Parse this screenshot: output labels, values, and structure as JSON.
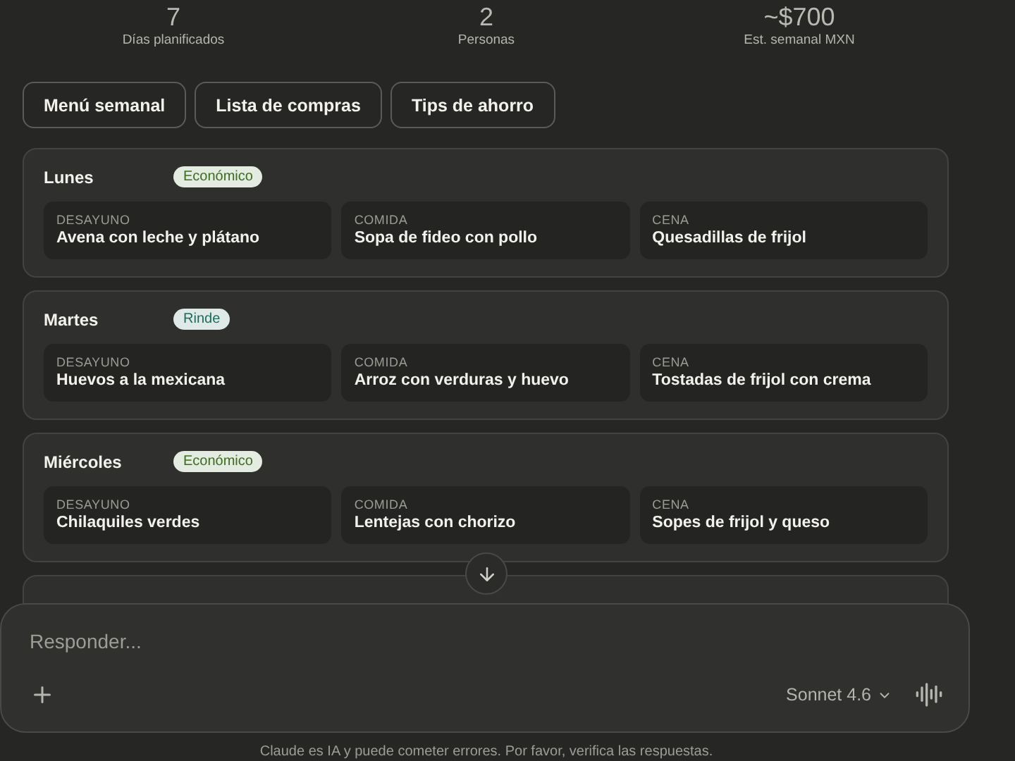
{
  "stats": [
    {
      "value": "7",
      "label": "Días planificados"
    },
    {
      "value": "2",
      "label": "Personas"
    },
    {
      "value": "~$700",
      "label": "Est. semanal MXN"
    }
  ],
  "tabs": [
    {
      "label": "Menú semanal"
    },
    {
      "label": "Lista de compras"
    },
    {
      "label": "Tips de ahorro"
    }
  ],
  "days": [
    {
      "day": "Lunes",
      "tag": {
        "label": "Económico",
        "color": "#3b6d1f"
      },
      "meals": [
        {
          "type": "DESAYUNO",
          "dish": "Avena con leche y plátano"
        },
        {
          "type": "COMIDA",
          "dish": "Sopa de fideo con pollo"
        },
        {
          "type": "CENA",
          "dish": "Quesadillas de frijol"
        }
      ]
    },
    {
      "day": "Martes",
      "tag": {
        "label": "Rinde",
        "color": "#1c6b5a"
      },
      "meals": [
        {
          "type": "DESAYUNO",
          "dish": "Huevos a la mexicana"
        },
        {
          "type": "COMIDA",
          "dish": "Arroz con verduras y huevo"
        },
        {
          "type": "CENA",
          "dish": "Tostadas de frijol con crema"
        }
      ]
    },
    {
      "day": "Miércoles",
      "tag": {
        "label": "Económico",
        "color": "#3b6d1f"
      },
      "meals": [
        {
          "type": "DESAYUNO",
          "dish": "Chilaquiles verdes"
        },
        {
          "type": "COMIDA",
          "dish": "Lentejas con chorizo"
        },
        {
          "type": "CENA",
          "dish": "Sopes de frijol y queso"
        }
      ]
    }
  ],
  "composer": {
    "placeholder": "Responder...",
    "model": "Sonnet 4.6"
  },
  "disclaimer": "Claude es IA y puede cometer errores. Por favor, verifica las respuestas."
}
